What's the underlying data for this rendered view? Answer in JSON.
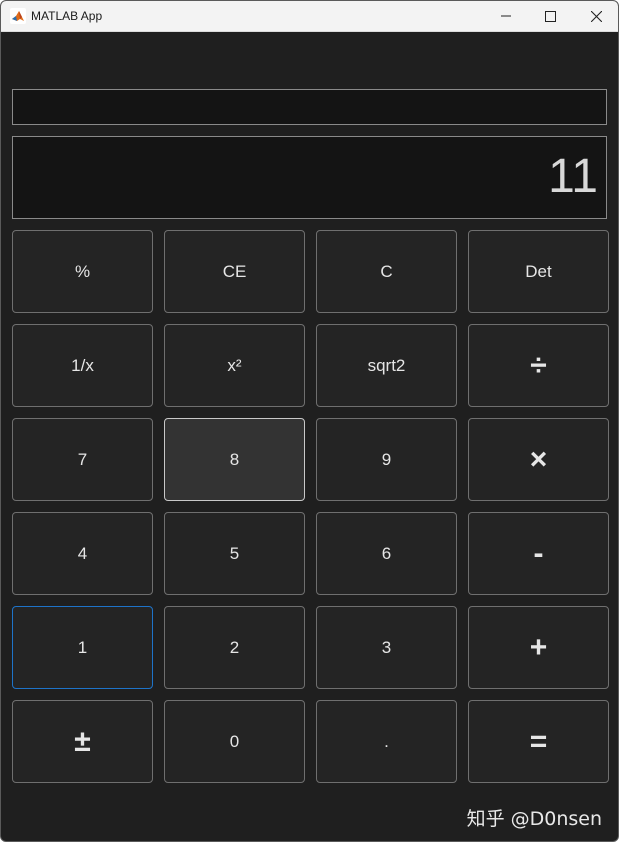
{
  "window": {
    "title": "MATLAB App"
  },
  "display": {
    "expression": "",
    "result": "11"
  },
  "keys": [
    {
      "label": "%"
    },
    {
      "label": "CE"
    },
    {
      "label": "C"
    },
    {
      "label": "Det"
    },
    {
      "label": "1/x"
    },
    {
      "label": "x²"
    },
    {
      "label": "sqrt2"
    },
    {
      "label": "÷"
    },
    {
      "label": "7"
    },
    {
      "label": "8"
    },
    {
      "label": "9"
    },
    {
      "label": "×"
    },
    {
      "label": "4"
    },
    {
      "label": "5"
    },
    {
      "label": "6"
    },
    {
      "label": "-"
    },
    {
      "label": "1"
    },
    {
      "label": "2"
    },
    {
      "label": "3"
    },
    {
      "label": "+"
    },
    {
      "label": "±"
    },
    {
      "label": "0"
    },
    {
      "label": "."
    },
    {
      "label": "="
    }
  ],
  "watermark": "知乎 @D0nsen",
  "colors": {
    "background": "#1f1f1f",
    "key": "#242424",
    "key_hover": "#333333",
    "focus_border": "#1e73c8"
  }
}
